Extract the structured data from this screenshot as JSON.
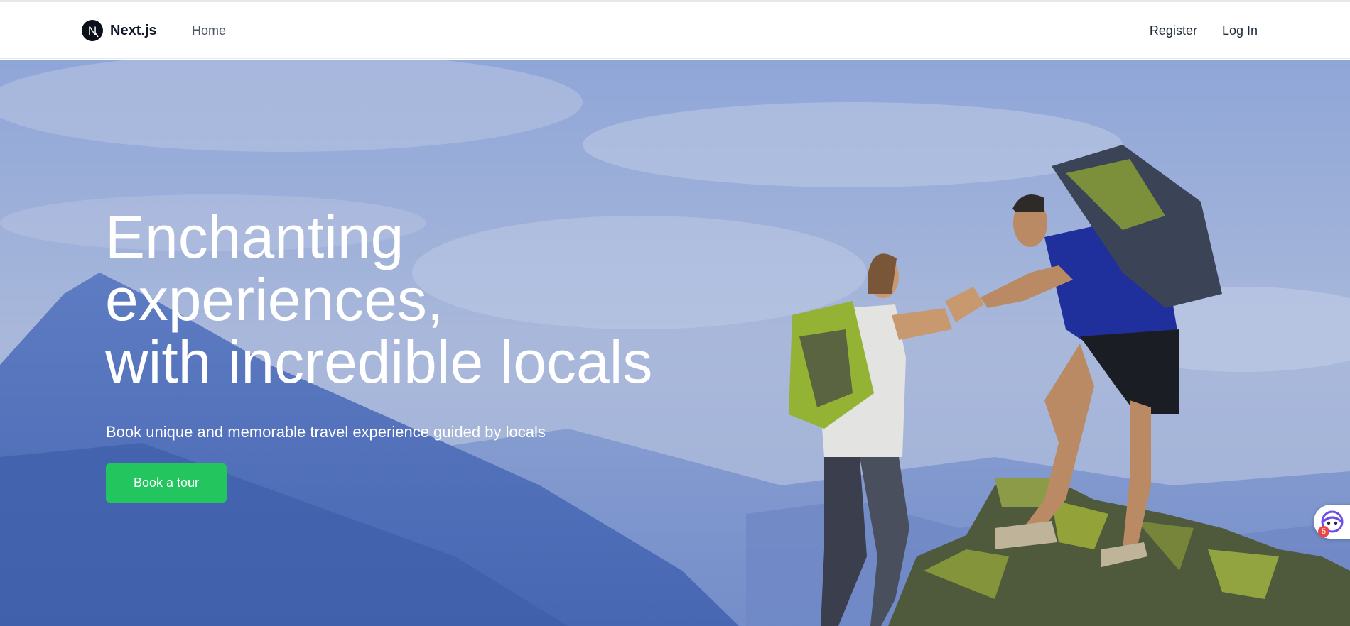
{
  "navbar": {
    "brand": "Next.js",
    "brand_logo_letter": "N",
    "home_label": "Home",
    "register_label": "Register",
    "login_label": "Log In"
  },
  "hero": {
    "title_lines": [
      "Enchanting",
      "experiences,",
      "with incredible locals"
    ],
    "subtitle": "Book unique and memorable travel experience guided by locals",
    "cta_label": "Book a tour"
  },
  "widget": {
    "badge_count": "5",
    "icon": "assistant-face-icon"
  },
  "colors": {
    "accent": "#22c55e",
    "text_dark": "#111827",
    "badge": "#ef4444"
  }
}
